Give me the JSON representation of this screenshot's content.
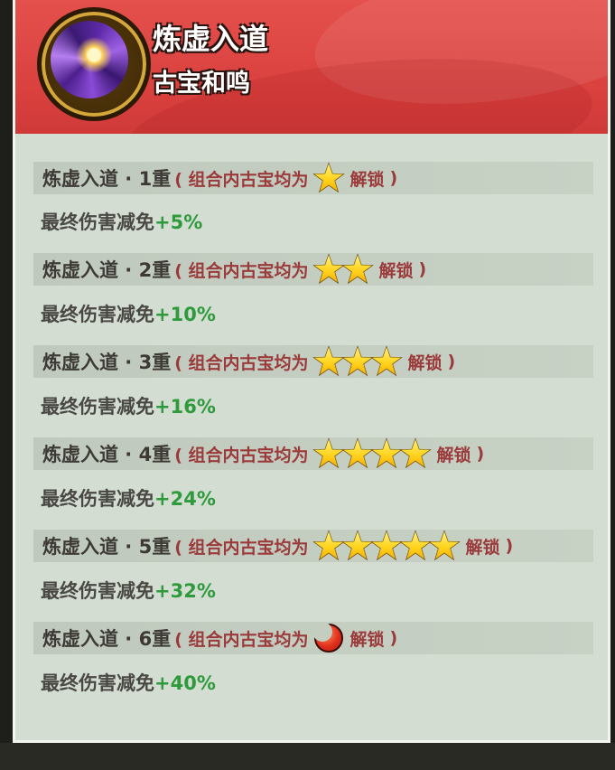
{
  "header": {
    "title": "炼虚入道",
    "subtitle": "古宝和鸣",
    "emblem_icon": "purple-vortex-emblem-icon"
  },
  "tiers": [
    {
      "name": "炼虚入道 · 1重",
      "cond_open": "( 组合内古宝均为",
      "icon": "star",
      "count": 1,
      "unlock": "解锁",
      "close": ")",
      "effect_label": "最终伤害减免",
      "effect_value": "+5%"
    },
    {
      "name": "炼虚入道 · 2重",
      "cond_open": "( 组合内古宝均为",
      "icon": "star",
      "count": 2,
      "unlock": "解锁",
      "close": ")",
      "effect_label": "最终伤害减免",
      "effect_value": "+10%"
    },
    {
      "name": "炼虚入道 · 3重",
      "cond_open": "( 组合内古宝均为",
      "icon": "star",
      "count": 3,
      "unlock": "解锁",
      "close": ")",
      "effect_label": "最终伤害减免",
      "effect_value": "+16%"
    },
    {
      "name": "炼虚入道 · 4重",
      "cond_open": "( 组合内古宝均为",
      "icon": "star",
      "count": 4,
      "unlock": "解锁",
      "close": ")",
      "effect_label": "最终伤害减免",
      "effect_value": "+24%"
    },
    {
      "name": "炼虚入道 · 5重",
      "cond_open": "( 组合内古宝均为",
      "icon": "star",
      "count": 5,
      "unlock": "解锁",
      "close": ")",
      "effect_label": "最终伤害减免",
      "effect_value": "+32%"
    },
    {
      "name": "炼虚入道 · 6重",
      "cond_open": "( 组合内古宝均为",
      "icon": "red-moon",
      "count": 1,
      "unlock": "解锁",
      "close": ")",
      "effect_label": "最终伤害减免",
      "effect_value": "+40%"
    }
  ],
  "colors": {
    "header_red": "#d9403e",
    "panel_bg": "#d3ddd2",
    "condition_text": "#9b3a3a",
    "effect_value_green": "#2e9a3c"
  }
}
